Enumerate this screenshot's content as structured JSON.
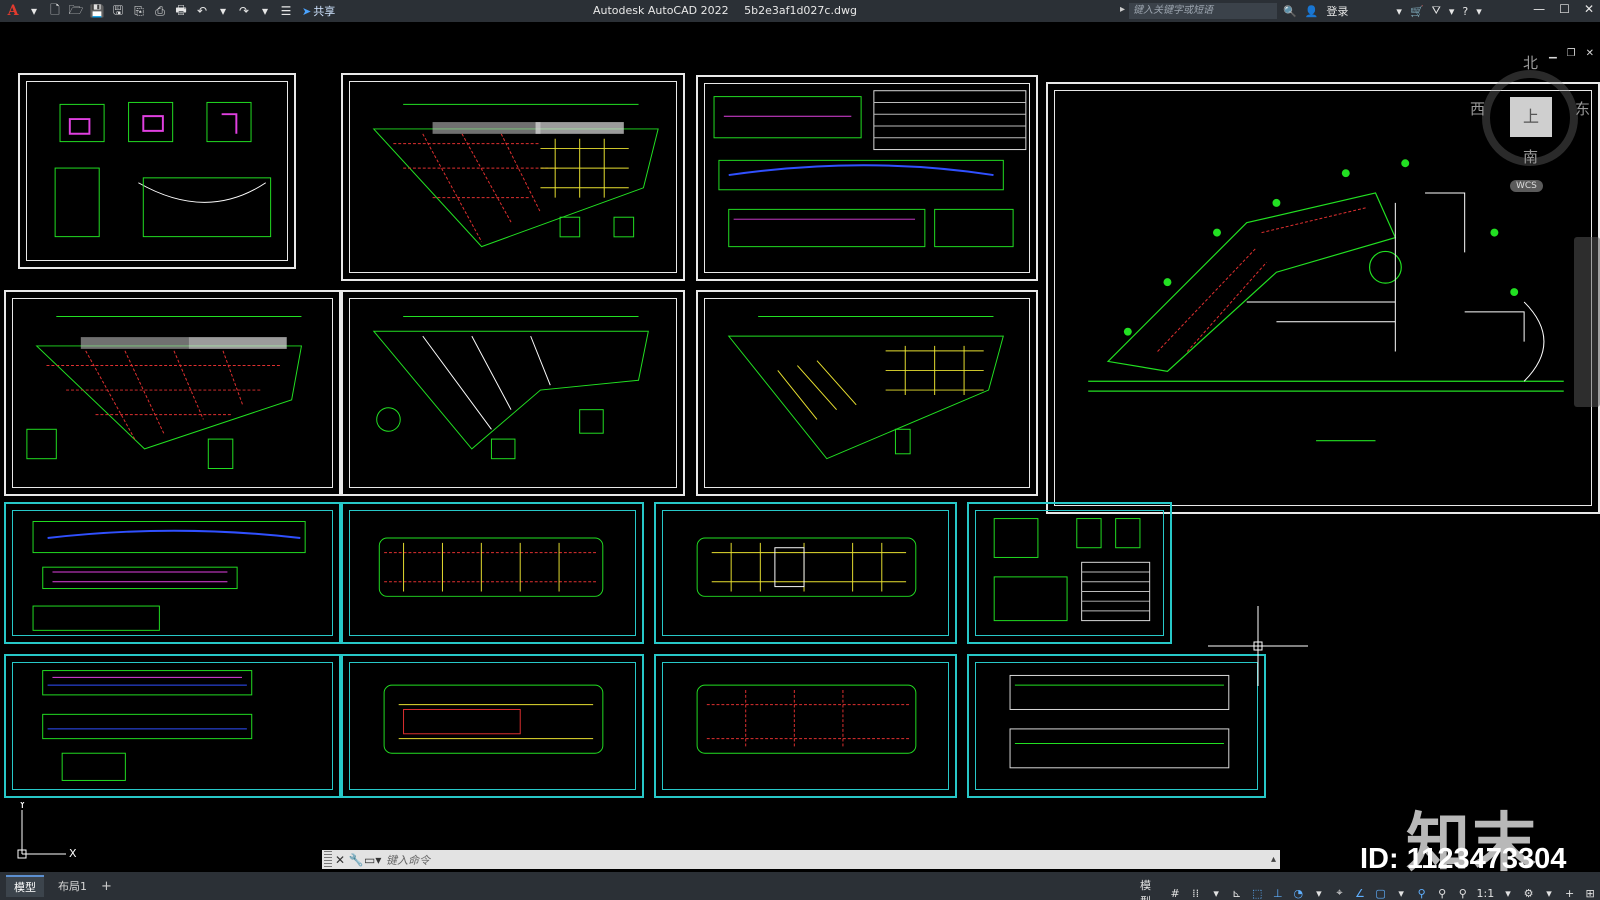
{
  "app": {
    "title": "Autodesk AutoCAD 2022",
    "filename": "5b2e3af1d027c.dwg",
    "logo": "A",
    "share_label": "共享",
    "search_placeholder": "键入关键字或短语",
    "login_label": "登录"
  },
  "viewcube": {
    "north": "北",
    "south": "南",
    "east": "东",
    "west": "西",
    "top": "上",
    "wcs": "WCS"
  },
  "command_line": {
    "placeholder": "键入命令"
  },
  "layout_tabs": [
    "模型",
    "布局1"
  ],
  "status_bar": {
    "model_label": "模型",
    "scale": "1:1"
  },
  "ucs": {
    "x": "X",
    "y": "Y"
  },
  "watermark": {
    "logo_text": "知末",
    "id_text": "ID: 1123473304"
  },
  "colors": {
    "drawing_bg": "#000000",
    "sheet_white": "#e8e8e8",
    "sheet_cyan": "#27c8c8",
    "green": "#22e022",
    "red": "#e03030",
    "magenta": "#e040e0",
    "yellow": "#e8e030",
    "blue": "#3050ff"
  }
}
